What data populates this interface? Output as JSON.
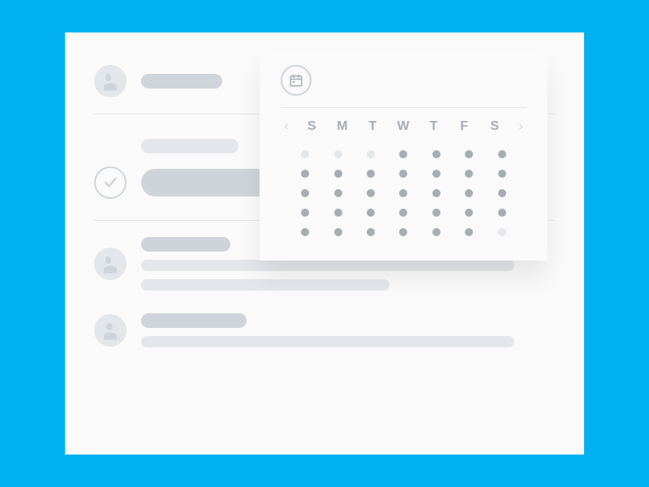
{
  "calendar": {
    "day_labels": [
      "S",
      "M",
      "T",
      "W",
      "T",
      "F",
      "S"
    ],
    "weeks": [
      [
        "dim",
        "dim",
        "dim",
        "normal",
        "normal",
        "normal",
        "normal"
      ],
      [
        "normal",
        "normal",
        "normal",
        "normal",
        "normal",
        "normal",
        "normal"
      ],
      [
        "normal",
        "normal",
        "normal",
        "normal",
        "normal",
        "normal",
        "normal"
      ],
      [
        "normal",
        "normal",
        "normal",
        "normal",
        "normal",
        "normal",
        "normal"
      ],
      [
        "normal",
        "normal",
        "normal",
        "normal",
        "normal",
        "normal",
        "dim"
      ]
    ],
    "prev_glyph": "‹",
    "next_glyph": "›"
  },
  "colors": {
    "brand": "#00b0f0",
    "muted": "#ced4da",
    "faint": "#e3e6ea",
    "text_muted": "#a6adb5"
  }
}
